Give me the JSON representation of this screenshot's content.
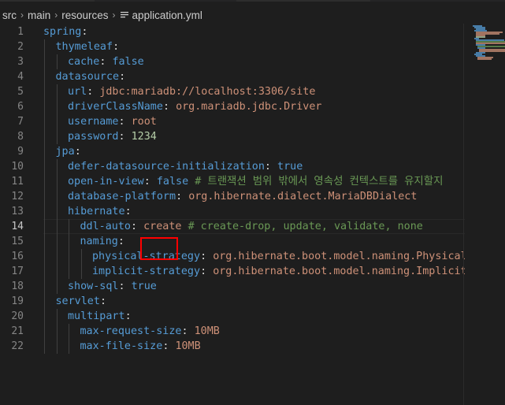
{
  "breadcrumb": {
    "items": [
      "src",
      "main",
      "resources"
    ],
    "file": "application.yml"
  },
  "editor": {
    "active_line": 14,
    "lines": [
      {
        "no": "1",
        "tokens": [
          {
            "t": "k",
            "v": "spring"
          },
          {
            "t": "p",
            "v": ":"
          }
        ]
      },
      {
        "no": "2",
        "tokens": [
          {
            "t": "k",
            "v": "thymeleaf"
          },
          {
            "t": "p",
            "v": ":"
          }
        ]
      },
      {
        "no": "3",
        "tokens": [
          {
            "t": "k",
            "v": "cache"
          },
          {
            "t": "p",
            "v": ": "
          },
          {
            "t": "k",
            "v": "false"
          }
        ]
      },
      {
        "no": "4",
        "tokens": [
          {
            "t": "k",
            "v": "datasource"
          },
          {
            "t": "p",
            "v": ":"
          }
        ]
      },
      {
        "no": "5",
        "tokens": [
          {
            "t": "k",
            "v": "url"
          },
          {
            "t": "p",
            "v": ": "
          },
          {
            "t": "s",
            "v": "jdbc:mariadb://localhost:3306/site"
          }
        ]
      },
      {
        "no": "6",
        "tokens": [
          {
            "t": "k",
            "v": "driverClassName"
          },
          {
            "t": "p",
            "v": ": "
          },
          {
            "t": "s",
            "v": "org.mariadb.jdbc.Driver"
          }
        ]
      },
      {
        "no": "7",
        "tokens": [
          {
            "t": "k",
            "v": "username"
          },
          {
            "t": "p",
            "v": ": "
          },
          {
            "t": "s",
            "v": "root"
          }
        ]
      },
      {
        "no": "8",
        "tokens": [
          {
            "t": "k",
            "v": "password"
          },
          {
            "t": "p",
            "v": ": "
          },
          {
            "t": "n",
            "v": "1234"
          }
        ]
      },
      {
        "no": "9",
        "tokens": [
          {
            "t": "k",
            "v": "jpa"
          },
          {
            "t": "p",
            "v": ":"
          }
        ]
      },
      {
        "no": "10",
        "tokens": [
          {
            "t": "k",
            "v": "defer-datasource-initialization"
          },
          {
            "t": "p",
            "v": ": "
          },
          {
            "t": "k",
            "v": "true"
          }
        ]
      },
      {
        "no": "11",
        "tokens": [
          {
            "t": "k",
            "v": "open-in-view"
          },
          {
            "t": "p",
            "v": ": "
          },
          {
            "t": "k",
            "v": "false"
          },
          {
            "t": "p",
            "v": " "
          },
          {
            "t": "c",
            "v": "# 트랜잭션 범위 밖에서 영속성 컨텍스트를 유지할지"
          }
        ]
      },
      {
        "no": "12",
        "tokens": [
          {
            "t": "k",
            "v": "database-platform"
          },
          {
            "t": "p",
            "v": ": "
          },
          {
            "t": "s",
            "v": "org.hibernate.dialect.MariaDBDialect"
          }
        ]
      },
      {
        "no": "13",
        "tokens": [
          {
            "t": "k",
            "v": "hibernate"
          },
          {
            "t": "p",
            "v": ":"
          }
        ]
      },
      {
        "no": "14",
        "tokens": [
          {
            "t": "k",
            "v": "ddl-auto"
          },
          {
            "t": "p",
            "v": ": "
          },
          {
            "t": "s",
            "v": "create"
          },
          {
            "t": "p",
            "v": " "
          },
          {
            "t": "c",
            "v": "# create-drop, update, validate, none"
          }
        ]
      },
      {
        "no": "15",
        "tokens": [
          {
            "t": "k",
            "v": "naming"
          },
          {
            "t": "p",
            "v": ":"
          }
        ]
      },
      {
        "no": "16",
        "tokens": [
          {
            "t": "k",
            "v": "physical-strategy"
          },
          {
            "t": "p",
            "v": ": "
          },
          {
            "t": "s",
            "v": "org.hibernate.boot.model.naming.PhysicalNam"
          }
        ]
      },
      {
        "no": "17",
        "tokens": [
          {
            "t": "k",
            "v": "implicit-strategy"
          },
          {
            "t": "p",
            "v": ": "
          },
          {
            "t": "s",
            "v": "org.hibernate.boot.model.naming.ImplicitNam"
          }
        ]
      },
      {
        "no": "18",
        "tokens": [
          {
            "t": "k",
            "v": "show-sql"
          },
          {
            "t": "p",
            "v": ": "
          },
          {
            "t": "k",
            "v": "true"
          }
        ]
      },
      {
        "no": "19",
        "tokens": [
          {
            "t": "k",
            "v": "servlet"
          },
          {
            "t": "p",
            "v": ":"
          }
        ]
      },
      {
        "no": "20",
        "tokens": [
          {
            "t": "k",
            "v": "multipart"
          },
          {
            "t": "p",
            "v": ":"
          }
        ]
      },
      {
        "no": "21",
        "tokens": [
          {
            "t": "k",
            "v": "max-request-size"
          },
          {
            "t": "p",
            "v": ": "
          },
          {
            "t": "s",
            "v": "10MB"
          }
        ]
      },
      {
        "no": "22",
        "tokens": [
          {
            "t": "k",
            "v": "max-file-size"
          },
          {
            "t": "p",
            "v": ": "
          },
          {
            "t": "s",
            "v": "10MB"
          }
        ]
      }
    ]
  },
  "colors": {
    "key": "#569cd6",
    "string": "#ce9178",
    "number": "#b5cea8",
    "comment": "#6a9955",
    "highlight_box": "#ff0000"
  }
}
